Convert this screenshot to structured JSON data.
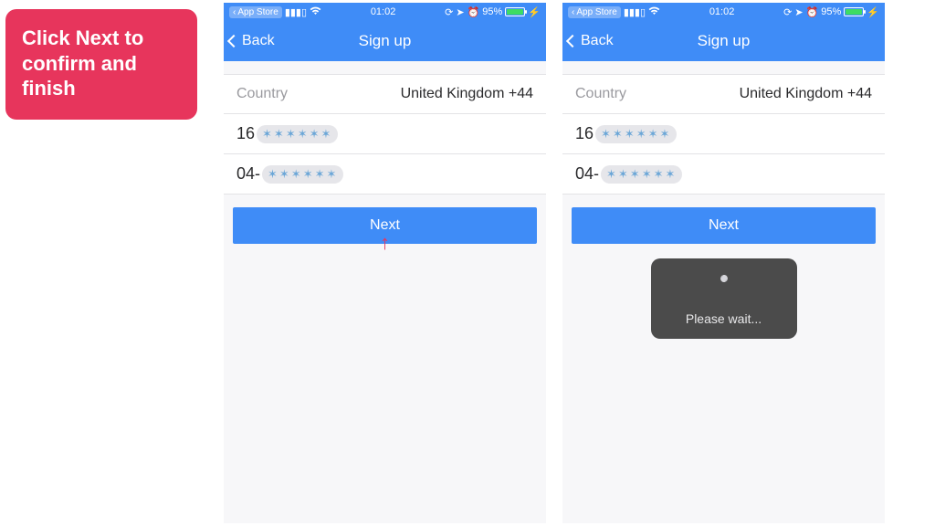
{
  "callout": {
    "text": "Click Next to confirm and finish"
  },
  "status_bar": {
    "breadcrumb": "App Store",
    "time": "01:02",
    "battery_pct": "95%"
  },
  "nav": {
    "back_label": "Back",
    "title": "Sign up"
  },
  "form": {
    "country_label": "Country",
    "country_value": "United Kingdom +44",
    "phone_prefix": "16",
    "password_prefix": "04-",
    "next_label": "Next"
  },
  "toast": {
    "text": "Please wait..."
  },
  "colors": {
    "primary": "#3f8cf7",
    "accent": "#e7355c"
  }
}
